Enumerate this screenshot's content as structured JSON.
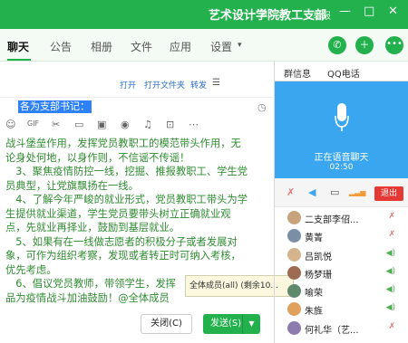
{
  "window": {
    "title": "艺术设计学院教工支部",
    "report_label": "举报",
    "minimize": "—",
    "maximize": "□",
    "close": "✕"
  },
  "tabs": [
    {
      "label": "聊天"
    },
    {
      "label": "公告"
    },
    {
      "label": "相册"
    },
    {
      "label": "文件"
    },
    {
      "label": "应用"
    },
    {
      "label": "设置"
    }
  ],
  "file_actions": {
    "open": "打开",
    "open_folder": "打开文件夹",
    "forward": "转发"
  },
  "quoted_text": "各为支部书记：",
  "editor": {
    "lines": [
      "战斗堡垒作用，发挥党员教职工的模范带头作用，无",
      "论身处何地，以身作则，不信谣不传谣！",
      "　3、聚焦疫情防控一线，挖掘、推报教职工、学生党",
      "员典型，让党旗飘扬在一线。",
      "　4、了解今年严峻的就业形式，党员教职工带头为学",
      "生提供就业渠道，学生党员要带头树立正确就业观",
      "点，先就业再择业，鼓励到基层就业。",
      "　5、如果有在一线做志愿者的积极分子或者发展对",
      "象，可作为组织考察，发现或者转正时可纳入考核，",
      "优先考虑。",
      "　6、倡议党员教师，带领学生，发挥",
      "品为疫情战斗加油鼓励！@全体成员"
    ]
  },
  "mention_popup": {
    "text": "全体成员(all) (剩余10..."
  },
  "buttons": {
    "close": "关闭(C)",
    "send": "发送(S)"
  },
  "side_tabs": {
    "group_info": "群信息",
    "qq_call": "QQ电话"
  },
  "call": {
    "status": "正在语音聊天",
    "duration": "02:50",
    "exit": "退出"
  },
  "members": [
    {
      "name": "二支部李佋...",
      "status": "muted"
    },
    {
      "name": "黄菁",
      "status": "muted"
    },
    {
      "name": "吕凯悦",
      "status": "speaking"
    },
    {
      "name": "杨梦珊",
      "status": "speaking"
    },
    {
      "name": "喻荣",
      "status": "speaking"
    },
    {
      "name": "朱旌",
      "status": "speaking"
    },
    {
      "name": "何礼华（艺...",
      "status": "muted"
    }
  ],
  "colors": {
    "brand": "#22b14c",
    "call_panel": "#3aa6f0",
    "exit": "#e53935",
    "editor_text": "#2e8b30",
    "selection": "#2f81f7"
  }
}
